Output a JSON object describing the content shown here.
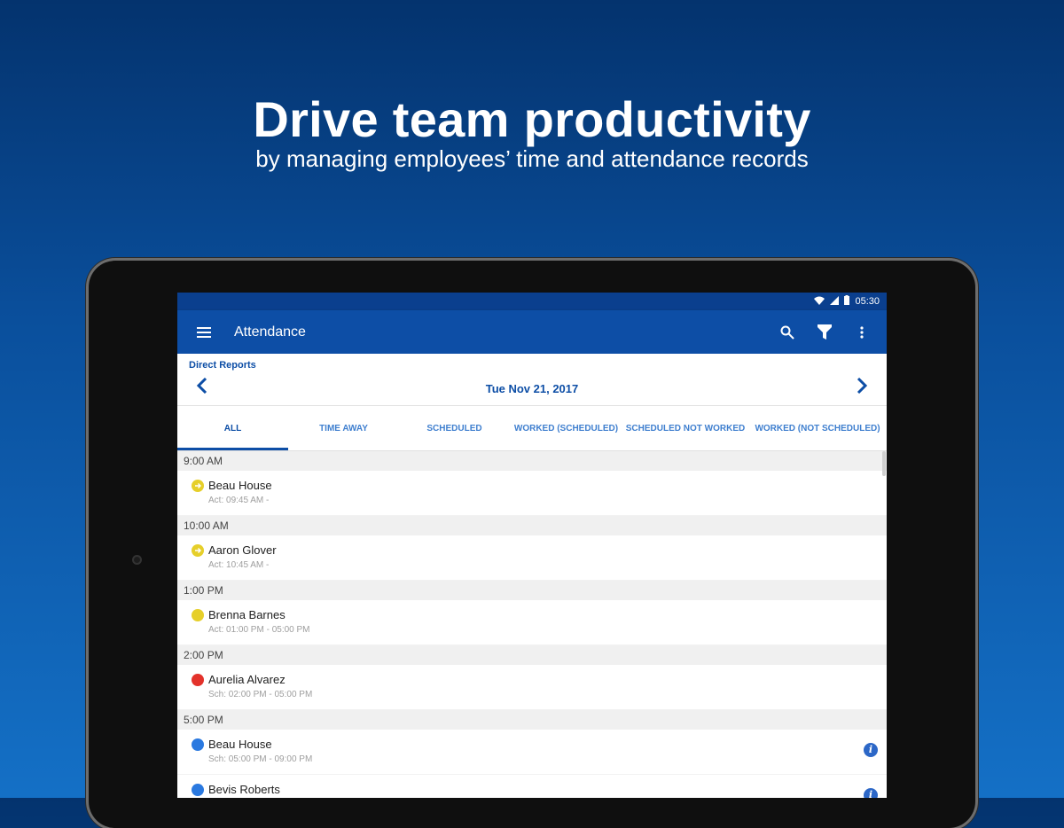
{
  "promo": {
    "headline": "Drive team productivity",
    "subline": "by managing employees’ time and attendance records"
  },
  "status_bar": {
    "time": "05:30"
  },
  "app_bar": {
    "title": "Attendance",
    "icons": [
      "menu-icon",
      "search-icon",
      "filter-icon",
      "more-vert-icon"
    ]
  },
  "subheader": {
    "label": "Direct Reports",
    "date": "Tue Nov 21, 2017"
  },
  "tabs": [
    {
      "label": "ALL",
      "active": true
    },
    {
      "label": "TIME AWAY",
      "active": false
    },
    {
      "label": "SCHEDULED",
      "active": false
    },
    {
      "label": "WORKED (SCHEDULED)",
      "active": false
    },
    {
      "label": "SCHEDULED NOT WORKED",
      "active": false
    },
    {
      "label": "WORKED (NOT SCHEDULED)",
      "active": false
    }
  ],
  "groups": [
    {
      "time": "9:00 AM",
      "rows": [
        {
          "name": "Beau House",
          "detail": "Act: 09:45 AM -",
          "status": "yellow-arrow",
          "info": false
        }
      ]
    },
    {
      "time": "10:00 AM",
      "rows": [
        {
          "name": "Aaron Glover",
          "detail": "Act: 10:45 AM -",
          "status": "yellow-arrow",
          "info": false
        }
      ]
    },
    {
      "time": "1:00 PM",
      "rows": [
        {
          "name": "Brenna Barnes",
          "detail": "Act: 01:00 PM - 05:00 PM",
          "status": "yellow",
          "info": false
        }
      ]
    },
    {
      "time": "2:00 PM",
      "rows": [
        {
          "name": "Aurelia Alvarez",
          "detail": "Sch: 02:00 PM - 05:00 PM",
          "status": "red",
          "info": false
        }
      ]
    },
    {
      "time": "5:00 PM",
      "rows": [
        {
          "name": "Beau House",
          "detail": "Sch: 05:00 PM - 09:00 PM",
          "status": "blue",
          "info": true
        },
        {
          "name": "Bevis Roberts",
          "detail": "",
          "status": "blue",
          "info": true
        }
      ]
    }
  ],
  "colors": {
    "yellow": "#e6cf2a",
    "red": "#e3322b",
    "blue": "#2a79e0",
    "app_bar": "#0d4ea6"
  }
}
